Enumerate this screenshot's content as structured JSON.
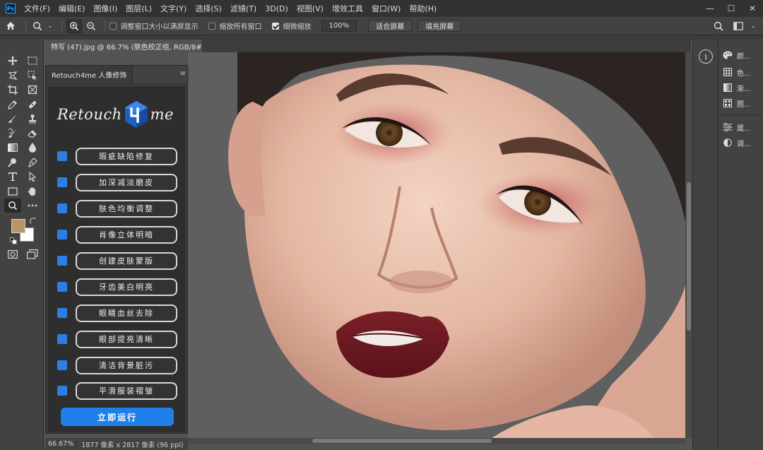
{
  "app": {
    "logo": "Ps"
  },
  "menu": [
    "文件(F)",
    "编辑(E)",
    "图像(I)",
    "图层(L)",
    "文字(Y)",
    "选择(S)",
    "滤镜(T)",
    "3D(D)",
    "视图(V)",
    "增效工具",
    "窗口(W)",
    "帮助(H)"
  ],
  "window_controls": {
    "minimize": "—",
    "maximize": "☐",
    "close": "✕"
  },
  "options": {
    "resize_windows": "调整窗口大小以满屏显示",
    "zoom_all": "缩放所有窗口",
    "scrubby_zoom": "细微缩放",
    "zoom_value": "100%",
    "fit_screen": "适合屏幕",
    "fill_screen": "填充屏幕"
  },
  "document": {
    "tab_title": "特写 (47).jpg @ 66.7% (肤色校正组, RGB/8#) *",
    "close": "×"
  },
  "plugin": {
    "tab_label": "Retouch4me 人像修饰",
    "logo_left": "Retouch",
    "logo_right": "me",
    "options": [
      "瑕疵缺陷修复",
      "加深减淡磨皮",
      "肤色均衡调整",
      "肖像立体明暗",
      "创建皮肤蒙版",
      "牙齿美白明亮",
      "眼睛血丝去除",
      "眼部提亮清晰",
      "清洁背景脏污",
      "平滑服装褶皱"
    ],
    "run_button": "立即运行"
  },
  "status": {
    "zoom": "66.67%",
    "dimensions": "1877 像素 x 2817 像素 (96 ppi)"
  },
  "right_panels": [
    {
      "icon": "color-palette-icon",
      "label": "颜..."
    },
    {
      "icon": "swatches-grid-icon",
      "label": "色..."
    },
    {
      "icon": "gradient-icon",
      "label": "渐..."
    },
    {
      "icon": "pattern-icon",
      "label": "图..."
    },
    {
      "icon": "properties-icon",
      "label": "属..."
    },
    {
      "icon": "adjustments-icon",
      "label": "调..."
    }
  ],
  "info_panel": "i",
  "colors": {
    "foreground": "#b8976a",
    "background": "#ffffff",
    "plugin_checkbox": "#2b7fe2",
    "run_button": "#1f80ea",
    "canvas_bg": "#5f5f5f"
  }
}
